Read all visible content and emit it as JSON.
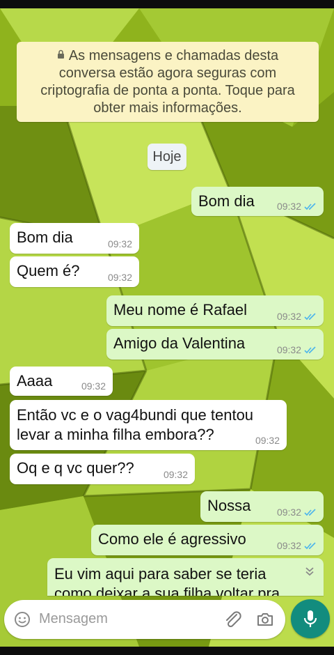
{
  "encryption_notice": {
    "lines": [
      "As mensagens e chamadas desta",
      "conversa estão agora seguras com",
      "criptografia de ponta a ponta. Toque para",
      "obter mais informações."
    ]
  },
  "date_chip": "Hoje",
  "messages": [
    {
      "direction": "out",
      "text": "Bom dia",
      "time": "09:32",
      "read": true
    },
    {
      "direction": "in",
      "text": "Bom dia",
      "time": "09:32"
    },
    {
      "direction": "in",
      "text": "Quem é?",
      "time": "09:32"
    },
    {
      "direction": "out",
      "text": "Meu nome é Rafael",
      "time": "09:32",
      "read": true
    },
    {
      "direction": "out",
      "text": "Amigo da Valentina",
      "time": "09:32",
      "read": true
    },
    {
      "direction": "in",
      "text": "Aaaa",
      "time": "09:32"
    },
    {
      "direction": "in",
      "text_lines": [
        "Então vc e o vag4bundi que tentou",
        "levar a minha filha embora??"
      ],
      "time": "09:32"
    },
    {
      "direction": "in",
      "text": "Oq e q vc quer??",
      "time": "09:32"
    },
    {
      "direction": "out",
      "text": "Nossa",
      "time": "09:32",
      "read": true
    },
    {
      "direction": "out",
      "text": "Como ele é agressivo",
      "time": "09:32",
      "read": true
    },
    {
      "direction": "out",
      "text_lines": [
        "Eu vim aqui para saber se teria",
        "como deixar a sua filha voltar pra"
      ],
      "partial": true
    }
  ],
  "composer": {
    "placeholder": "Mensagem"
  },
  "icons": {
    "lock": "lock-icon",
    "read_receipt": "double-check-icon",
    "scroll_down": "double-chevron-down-icon",
    "emoji": "emoji-icon",
    "attach": "paperclip-icon",
    "camera": "camera-icon",
    "mic": "microphone-icon"
  },
  "colors": {
    "wallpaper": "#8fb31d",
    "incoming_bubble": "#ffffff",
    "outgoing_bubble": "#dcf8c6",
    "encryption_notice": "#fbf3c4",
    "read_ticks": "#4fb6ec",
    "mic_button": "#128c7e"
  }
}
